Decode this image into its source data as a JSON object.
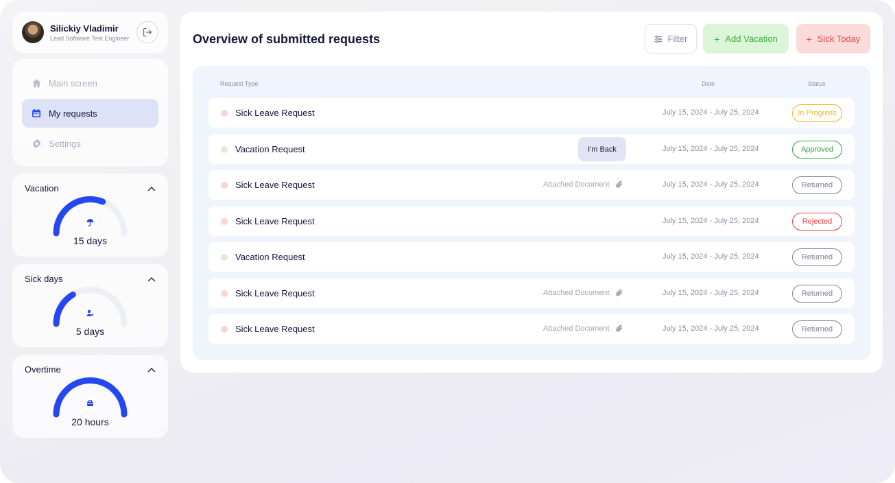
{
  "profile": {
    "name": "Silickiy Vladimir",
    "role": "Lead Software Test Engineer",
    "avatar_icon": "user-photo",
    "logout_icon": "logout-icon"
  },
  "nav": {
    "items": [
      {
        "label": "Main screen",
        "icon": "home-icon",
        "active": false
      },
      {
        "label": "My requests",
        "icon": "calendar-icon",
        "active": true
      },
      {
        "label": "Settings",
        "icon": "gear-icon",
        "active": false
      }
    ]
  },
  "widgets": {
    "vacation": {
      "title": "Vacation",
      "value": "15 days",
      "icon": "umbrella-icon",
      "fill": 0.62
    },
    "sick": {
      "title": "Sick days",
      "value": "5 days",
      "icon": "medical-icon",
      "fill": 0.33
    },
    "overtime": {
      "title": "Overtime",
      "value": "20 hours",
      "icon": "briefcase-icon",
      "fill": 1.0
    }
  },
  "main": {
    "title": "Overview of submitted requests",
    "filter_label": "Filter",
    "add_vacation_label": "Add Vacation",
    "sick_today_label": "Sick Today",
    "table": {
      "headers": {
        "type": "Request Type",
        "date": "Date",
        "status": "Status"
      },
      "rows": [
        {
          "type": "Sick Leave Request",
          "kind": "sick",
          "date": "July 15, 2024 - July 25, 2024",
          "status": "In Progress",
          "status_kind": "progress",
          "extra": ""
        },
        {
          "type": "Vacation Request",
          "kind": "vacation",
          "date": "July 15, 2024 - July 25, 2024",
          "status": "Approved",
          "status_kind": "approved",
          "extra": "back",
          "back_label": "I'm Back"
        },
        {
          "type": "Sick Leave Request",
          "kind": "sick",
          "date": "July 15, 2024 - July 25, 2024",
          "status": "Returned",
          "status_kind": "returned",
          "extra": "attach",
          "attach_label": "Attached Document"
        },
        {
          "type": "Sick Leave Request",
          "kind": "sick",
          "date": "July 15, 2024 - July 25, 2024",
          "status": "Rejected",
          "status_kind": "rejected",
          "extra": ""
        },
        {
          "type": "Vacation Request",
          "kind": "vacation",
          "date": "July 15, 2024 - July 25, 2024",
          "status": "Returned",
          "status_kind": "returned",
          "extra": ""
        },
        {
          "type": "Sick Leave Request",
          "kind": "sick",
          "date": "July 15, 2024 - July 25, 2024",
          "status": "Returned",
          "status_kind": "returned",
          "extra": "attach",
          "attach_label": "Attached Document"
        },
        {
          "type": "Sick Leave Request",
          "kind": "sick",
          "date": "July 15, 2024 - July 25, 2024",
          "status": "Returned",
          "status_kind": "returned",
          "extra": "attach",
          "attach_label": "Attached Document"
        }
      ]
    }
  },
  "colors": {
    "accent": "#2447f0",
    "gauge_track": "#eeeff4",
    "sick_dot": "#fbd3d3",
    "vacation_dot": "#d7f0d4",
    "progress": "#f0b51e",
    "approved": "#2ea043",
    "rejected": "#ef3b3b",
    "returned": "#7d8094"
  }
}
